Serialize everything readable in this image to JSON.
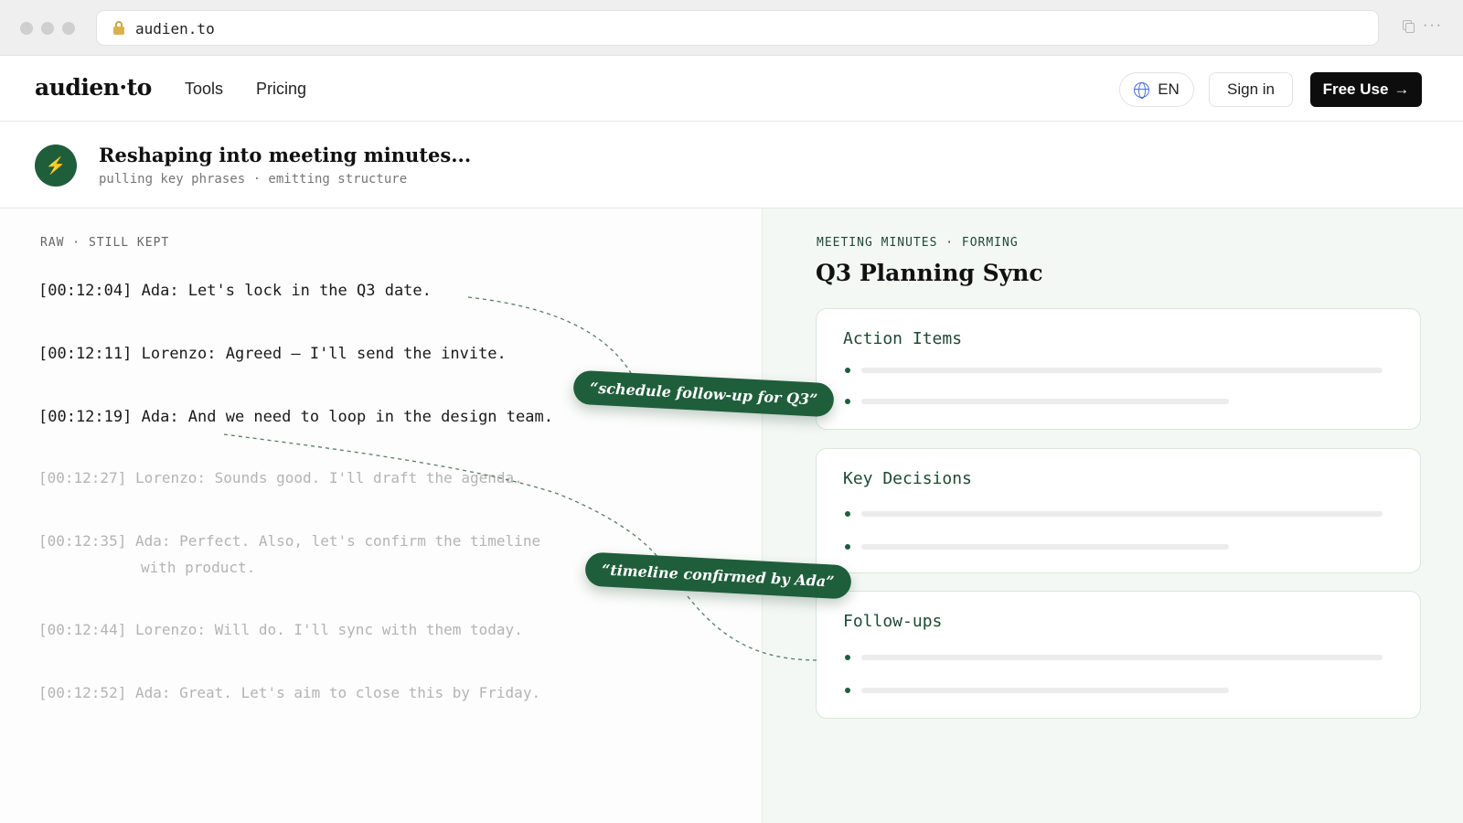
{
  "browser": {
    "url": "audien.to"
  },
  "nav": {
    "logo": "audien·to",
    "links": [
      "Tools",
      "Pricing"
    ],
    "language": "EN",
    "sign_in": "Sign in",
    "cta": "Free Use",
    "cta_arrow": "→"
  },
  "status": {
    "icon": "bolt-icon",
    "title": "Reshaping into meeting minutes...",
    "subtitle": "pulling key phrases · emitting structure"
  },
  "transcript": {
    "label": "RAW · STILL KEPT",
    "lines": [
      {
        "ts": "[00:12:04]",
        "text": "Ada: Let's lock in the Q3 date."
      },
      {
        "ts": "[00:12:11]",
        "text": "Lorenzo: Agreed — I'll send the invite."
      },
      {
        "ts": "[00:12:19]",
        "text": "Ada: And we need to loop in the design team."
      },
      {
        "ts": "[00:12:27]",
        "text": "Lorenzo: Sounds good. I'll draft the agenda."
      },
      {
        "ts": "[00:12:35]",
        "text": "Ada: Perfect. Also, let's confirm the timeline",
        "cont": "with product."
      },
      {
        "ts": "[00:12:44]",
        "text": "Lorenzo: Will do. I'll sync with them today."
      },
      {
        "ts": "[00:12:52]",
        "text": "Ada: Great. Let's aim to close this by Friday."
      }
    ]
  },
  "minutes": {
    "label": "MEETING MINUTES · FORMING",
    "title": "Q3 Planning Sync",
    "sections": [
      {
        "title": "Action Items"
      },
      {
        "title": "Key Decisions"
      },
      {
        "title": "Follow-ups"
      }
    ]
  },
  "chips": [
    "“schedule follow-up for Q3”",
    "“timeline confirmed by Ada”"
  ],
  "colors": {
    "accent": "#1f5e3b",
    "panel_bg": "#f4f8f5"
  }
}
